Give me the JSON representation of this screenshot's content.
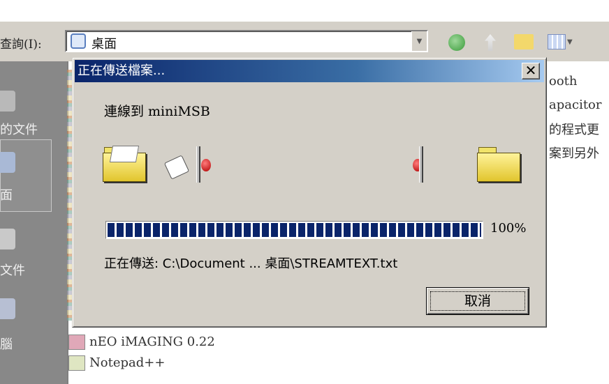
{
  "background": {
    "lookin_label": "查詢(I):",
    "lookin_value": "桌面",
    "sidebar_items": [
      "的文件",
      "面",
      "文件",
      "腦"
    ],
    "right_fragments": [
      "ooth",
      "apacitor",
      "的程式更",
      "案到另外"
    ],
    "file_items": [
      "nEO iMAGING 0.22",
      "Notepad++"
    ]
  },
  "dialog": {
    "title": "正在傳送檔案...",
    "close_label": "✕",
    "connecting_text": "連線到 miniMSB",
    "progress_value": 100,
    "percent_label": "100%",
    "status_text": "正在傳送: C:\\Document ... 桌面\\STREAMTEXT.txt",
    "cancel_label": "取消"
  },
  "colors": {
    "titlebar_start": "#0a246a",
    "titlebar_end": "#a6caf0",
    "progress_block": "#0a246a",
    "dialog_face": "#d4d0c8"
  }
}
